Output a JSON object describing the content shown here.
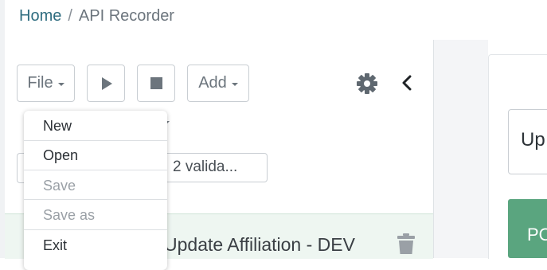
{
  "breadcrumb": {
    "home": "Home",
    "separator": "/",
    "current": "API Recorder"
  },
  "toolbar": {
    "file_label": "File",
    "add_label": "Add",
    "play_icon": "play-icon",
    "stop_icon": "stop-icon",
    "settings_icon": "gear-icon",
    "collapse_icon": "chevron-left-icon"
  },
  "file_menu": {
    "items": [
      {
        "label": "New",
        "enabled": true
      },
      {
        "label": "Open",
        "enabled": true
      },
      {
        "label": "Save",
        "enabled": false
      },
      {
        "label": "Save as",
        "enabled": false
      },
      {
        "label": "Exit",
        "enabled": true
      }
    ]
  },
  "filter": {
    "value": "2 valida..."
  },
  "list": {
    "items": [
      {
        "label": "Update Affiliation - DEV",
        "icon": "trash-icon"
      }
    ]
  },
  "right_panel": {
    "input_value": "Up",
    "button_label": "PO"
  },
  "colors": {
    "link": "#2f6d80",
    "selected_row": "#eef6f1",
    "green": "#5aa57f"
  }
}
